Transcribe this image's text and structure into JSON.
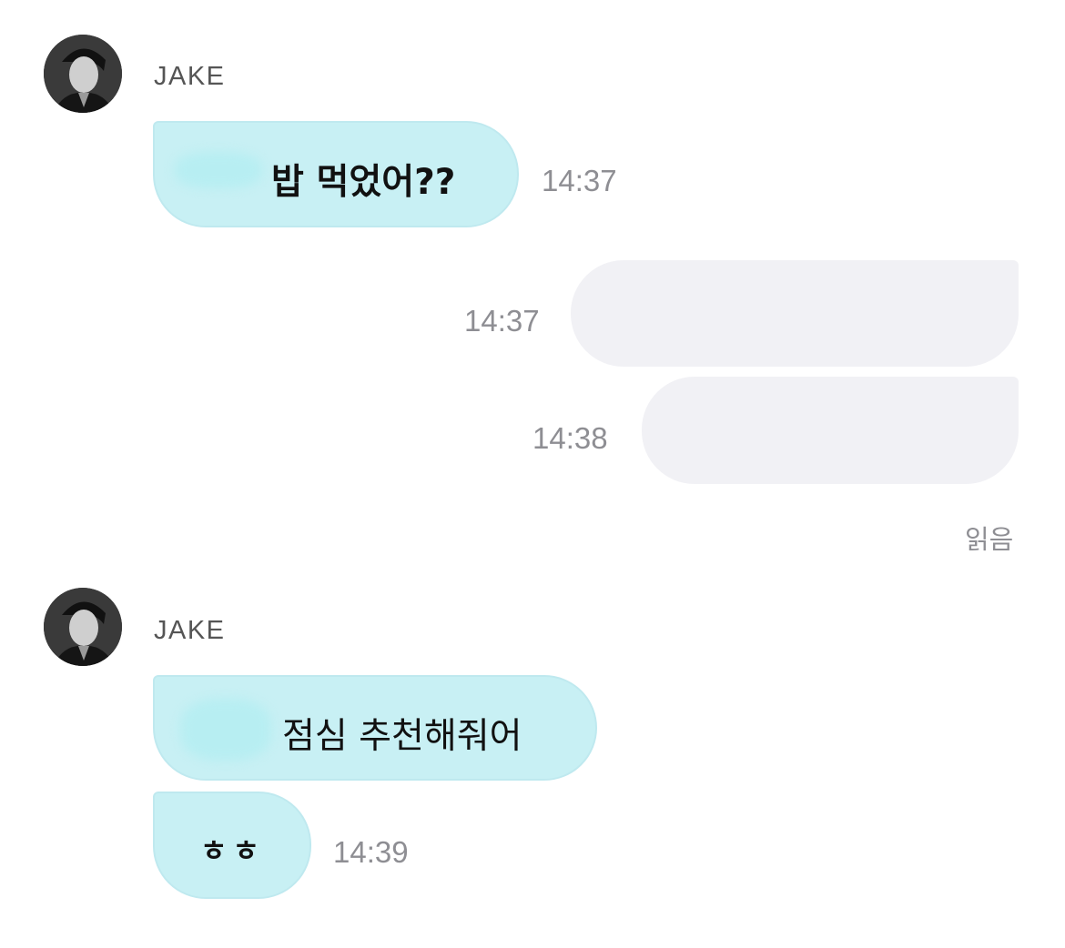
{
  "messages": [
    {
      "sender": "JAKE",
      "text": "밥 먹었어??",
      "time": "14:37",
      "direction": "incoming"
    },
    {
      "text": "",
      "time": "14:37",
      "direction": "outgoing"
    },
    {
      "text": "",
      "time": "14:38",
      "direction": "outgoing"
    },
    {
      "sender": "JAKE",
      "text": "점심 추천해줘어",
      "direction": "incoming"
    },
    {
      "text": "ㅎㅎ",
      "time": "14:39",
      "direction": "incoming"
    }
  ],
  "read_status": "읽음",
  "colors": {
    "incoming_bubble": "#c8f0f4",
    "outgoing_bubble": "#f1f1f5",
    "timestamp": "#8e8e93"
  },
  "icons": {
    "avatar": "profile-photo-avatar"
  }
}
